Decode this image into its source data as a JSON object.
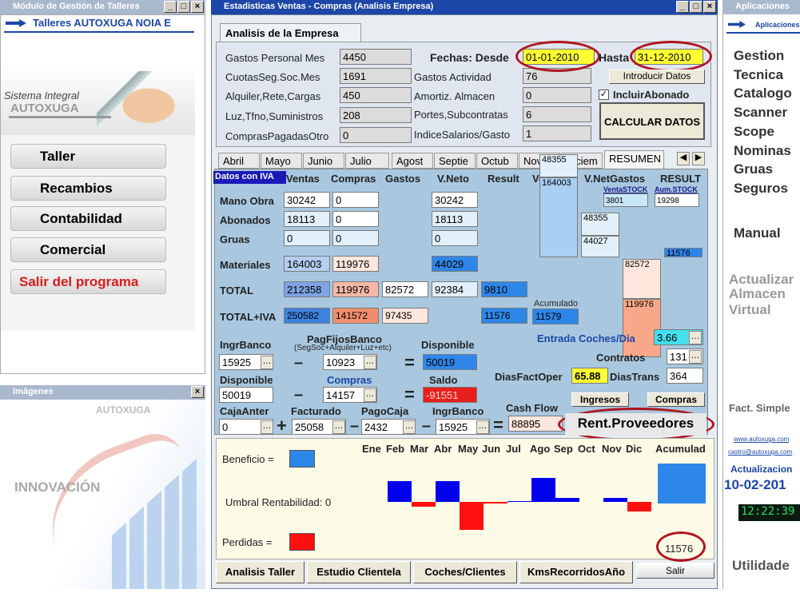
{
  "left_window": {
    "title": "Módulo de Gestión de Talleres",
    "company": "Talleres AUTOXUGA NOIA E",
    "slogan": "Sistema Integral",
    "brand": "AUTOXUGA",
    "menu": [
      "Taller",
      "Recambios",
      "Contabilidad",
      "Comercial",
      "Salir del programa"
    ]
  },
  "images_window": {
    "title": "Imágenes",
    "brand": "AUTOXUGA",
    "word": "INNOVACIÓN"
  },
  "right_window": {
    "title": "Aplicaciones",
    "subtitle": "Aplicaciones",
    "menu": [
      "Gestion",
      "Tecnica",
      "Catalogo",
      "Scanner",
      "Scope",
      "Nominas",
      "Gruas",
      "Seguros"
    ],
    "manual": "Manual",
    "actualizar": [
      "Actualizar",
      "Almacen",
      "Virtual"
    ],
    "fact": "Fact. Simple",
    "link1": "www.autoxuga.com",
    "link2": "castro@autoxuga.com",
    "actualiz_label": "Actualizacion",
    "actualiz_date": "10-02-201",
    "clock": "12:22:39",
    "utilidades": "Utilidade"
  },
  "main": {
    "title": "Estadisticas Ventas - Compras (Analisis Empresa)",
    "tab": "Analisis de la Empresa",
    "left_fields": [
      {
        "label": "Gastos Personal Mes",
        "value": "4450"
      },
      {
        "label": "CuotasSeg.Soc.Mes",
        "value": "1691"
      },
      {
        "label": "Alquiler,Rete,Cargas",
        "value": "450"
      },
      {
        "label": "Luz,Tfno,Suministros",
        "value": "208"
      },
      {
        "label": "ComprasPagadasOtro",
        "value": "0"
      }
    ],
    "mid_fields": [
      {
        "label": "Gastos Actividad",
        "value": "76"
      },
      {
        "label": "Amortiz. Almacen",
        "value": "0"
      },
      {
        "label": "Portes,Subcontratas",
        "value": "6"
      },
      {
        "label": "IndiceSalarios/Gasto",
        "value": "1"
      }
    ],
    "fechas_label": "Fechas: Desde",
    "desde": "01-01-2010",
    "hasta_label": "Hasta",
    "hasta": "31-12-2010",
    "introducir": "Introducir Datos",
    "incluir": "IncluirAbonado",
    "calcular": "CALCULAR DATOS",
    "months": [
      "Abril",
      "Mayo",
      "Junio",
      "Julio",
      "Agost",
      "Septie",
      "Octub",
      "Novie",
      "Diciem",
      "RESUMEN"
    ],
    "datos_iva": "Datos con IVA",
    "col_headers": [
      "Ventas",
      "Compras",
      "Gastos",
      "V.Neto",
      "Result",
      "Ventas",
      "V.NetGastos",
      "RESULT"
    ],
    "venta_stock_label": "VentaSTOCK",
    "venta_stock": "3801",
    "aum_stock_label": "Aum.STOCK",
    "aum_stock": "19298",
    "rows": [
      {
        "label": "Mano Obra",
        "ventas": "30242",
        "compras": "0",
        "vneto": "30242"
      },
      {
        "label": "Abonados",
        "ventas": "18113",
        "compras": "0",
        "vneto": "18113"
      },
      {
        "label": "Gruas",
        "ventas": "0",
        "compras": "0",
        "vneto": "0"
      },
      {
        "label": "Materiales",
        "ventas": "164003",
        "compras": "119976",
        "vneto": "44029"
      }
    ],
    "total": {
      "label": "TOTAL",
      "ventas": "212358",
      "compras": "119976",
      "gastos": "82572",
      "vneto": "92384",
      "result": "9810"
    },
    "total_iva": {
      "label": "TOTAL+IVA",
      "ventas": "250582",
      "compras": "141572",
      "gastos": "97435",
      "result": "11576"
    },
    "acumulado_label": "Acumulado",
    "acumulado": "11579",
    "ventas_bars": [
      "48355",
      "164003"
    ],
    "vnet_bars": [
      "48355",
      "44027"
    ],
    "gastos_bars": [
      "82572",
      "119976"
    ],
    "result_bar": "11576",
    "ingr_banco_label": "IngrBanco",
    "ingr_banco": "15925",
    "pagfijos_label": "PagFijosBanco",
    "pagfijos_sub": "(SegSoc+Alquiler+Luz+etc)",
    "pagfijos": "10923",
    "disponible_label": "Disponible",
    "disponible": "50019",
    "compras_label": "Compras",
    "compras": "14157",
    "saldo_label": "Saldo",
    "saldo": "-91551",
    "entrada_label": "Entrada Coches/Dia",
    "entrada": "3.66",
    "contratos_label": "Contratos",
    "contratos": "131",
    "dias_fact_label": "DiasFactOper",
    "dias_fact": "65.88",
    "dias_trans_label": "DiasTrans",
    "dias_trans": "364",
    "ingresos_btn": "Ingresos",
    "compras_btn": "Compras",
    "caja_anter_label": "CajaAnter",
    "caja_anter": "0",
    "facturado_label": "Facturado",
    "facturado": "25058",
    "pago_caja_label": "PagoCaja",
    "pago_caja": "2432",
    "ingr_banco2": "15925",
    "cashflow_label": "Cash Flow",
    "cashflow": "88895",
    "rent_proveedores": "Rent.Proveedores",
    "beneficio": "Beneficio =",
    "umbral": "Umbral Rentabilidad: 0",
    "perdidas": "Perdidas =",
    "chart_months": [
      "Ene",
      "Feb",
      "Mar",
      "Abr",
      "May",
      "Jun",
      "Jul",
      "Ago",
      "Sep",
      "Oct",
      "Nov",
      "Dic"
    ],
    "acumul_label": "Acumulad",
    "acumul_value": "11576",
    "bottom_buttons": [
      "Analisis Taller",
      "Estudio Clientela",
      "Coches/Clientes",
      "KmsRecorridosAño"
    ],
    "salir": "Salir"
  },
  "colors": {
    "titlebar": "#1c46a8",
    "panel": "#dfe6ef",
    "chart_bg": "#fdfbe6",
    "positive": "#0000ee",
    "negative": "#ff1010",
    "highlight": "#b0141e"
  },
  "chart_data": {
    "type": "bar",
    "categories": [
      "Ene",
      "Feb",
      "Mar",
      "Abr",
      "May",
      "Jun",
      "Jul",
      "Ago",
      "Sep",
      "Oct",
      "Nov",
      "Dic"
    ],
    "values": [
      0,
      3800,
      -900,
      3800,
      -5100,
      -300,
      200,
      4400,
      800,
      0,
      800,
      -1700
    ],
    "acumulado": 11576,
    "legend": [
      "Beneficio",
      "Perdidas"
    ]
  }
}
